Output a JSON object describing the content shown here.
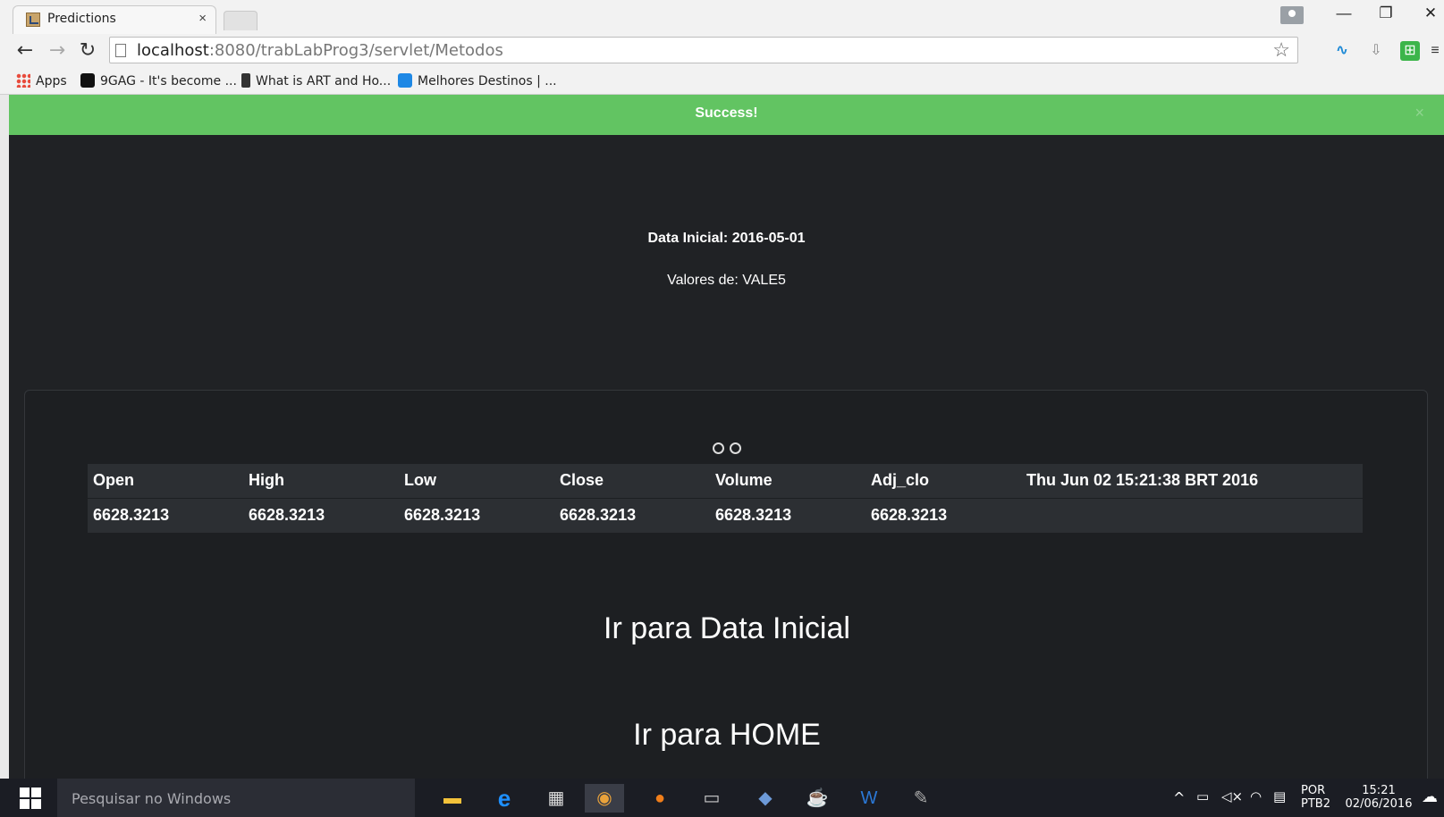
{
  "browser": {
    "tab_title": "Predictions",
    "tab_close": "×",
    "url_host": "localhost",
    "url_rest": ":8080/trabLabProg3/servlet/Metodos",
    "bookmarks": [
      {
        "label": "Apps",
        "icon": "apps-grid-icon"
      },
      {
        "label": "9GAG - It's become ...",
        "icon": "9gag-icon"
      },
      {
        "label": "What is ART and Ho...",
        "icon": "lock-icon"
      },
      {
        "label": "Melhores Destinos | ...",
        "icon": "melhores-destinos-icon"
      }
    ]
  },
  "alert": {
    "message": "Success!",
    "close": "×",
    "color": "#62c462"
  },
  "page": {
    "initial_date": "Data Inicial: 2016-05-01",
    "values_of": "Valores de: VALE5",
    "table": {
      "headers": [
        "Open",
        "High",
        "Low",
        "Close",
        "Volume",
        "Adj_clo",
        "Thu Jun 02 15:21:38 BRT 2016"
      ],
      "rows": [
        [
          "6628.3213",
          "6628.3213",
          "6628.3213",
          "6628.3213",
          "6628.3213",
          "6628.3213",
          ""
        ]
      ]
    },
    "link_initial_date": "Ir para Data Inicial",
    "link_home": "Ir para HOME"
  },
  "taskbar": {
    "search_placeholder": "Pesquisar no Windows",
    "lang_top": "POR",
    "lang_bottom": "PTB2",
    "time": "15:21",
    "date": "02/06/2016"
  },
  "colors": {
    "page_bg": "#202225",
    "panel_bg": "#1d1f22",
    "table_row_bg": "#2c2f33"
  }
}
